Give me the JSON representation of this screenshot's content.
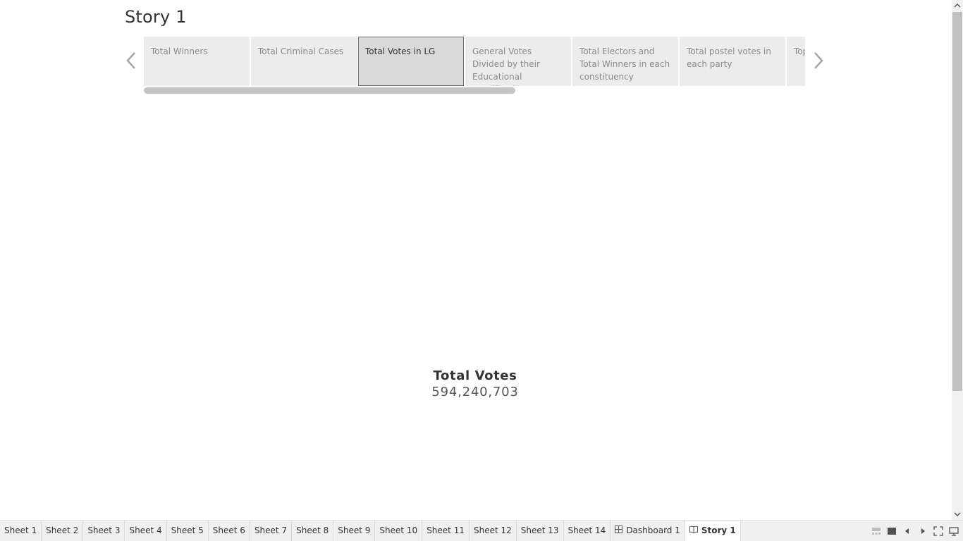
{
  "story": {
    "title": "Story 1"
  },
  "navigator": {
    "prev_icon": "chevron-left-icon",
    "next_icon": "chevron-right-icon",
    "points": [
      {
        "label": "Total Winners",
        "active": false
      },
      {
        "label": "Total Criminal Cases",
        "active": false
      },
      {
        "label": "Total Votes in LG",
        "active": true
      },
      {
        "label": "General Votes Divided by their Educational Qualification & Gender",
        "active": false
      },
      {
        "label": "Total Electors and Total Winners in each constituency",
        "active": false
      },
      {
        "label": "Total postel votes in each party",
        "active": false
      },
      {
        "label": "Top",
        "active": false
      }
    ]
  },
  "kpi": {
    "label": "Total Votes",
    "value": "594,240,703"
  },
  "tabbar": {
    "tabs": [
      {
        "label": "Sheet 1",
        "kind": "sheet",
        "active": false
      },
      {
        "label": "Sheet 2",
        "kind": "sheet",
        "active": false
      },
      {
        "label": "Sheet 3",
        "kind": "sheet",
        "active": false
      },
      {
        "label": "Sheet 4",
        "kind": "sheet",
        "active": false
      },
      {
        "label": "Sheet 5",
        "kind": "sheet",
        "active": false
      },
      {
        "label": "Sheet 6",
        "kind": "sheet",
        "active": false
      },
      {
        "label": "Sheet 7",
        "kind": "sheet",
        "active": false
      },
      {
        "label": "Sheet 8",
        "kind": "sheet",
        "active": false
      },
      {
        "label": "Sheet 9",
        "kind": "sheet",
        "active": false
      },
      {
        "label": "Sheet 10",
        "kind": "sheet",
        "active": false
      },
      {
        "label": "Sheet 11",
        "kind": "sheet",
        "active": false
      },
      {
        "label": "Sheet 12",
        "kind": "sheet",
        "active": false
      },
      {
        "label": "Sheet 13",
        "kind": "sheet",
        "active": false
      },
      {
        "label": "Sheet 14",
        "kind": "sheet",
        "active": false
      },
      {
        "label": "Dashboard 1",
        "kind": "dashboard",
        "active": false
      },
      {
        "label": "Story 1",
        "kind": "story",
        "active": true
      }
    ],
    "tools": [
      "filmstrip-view-icon",
      "tab-view-icon",
      "previous-sheet-icon",
      "next-sheet-icon",
      "fullscreen-icon",
      "presentation-mode-icon"
    ]
  },
  "colors": {
    "active_point_bg": "#d9d9d9",
    "point_bg": "#ececec",
    "scroll_thumb": "#c4c4c4",
    "tabbar_bg": "#f0f0f0"
  }
}
